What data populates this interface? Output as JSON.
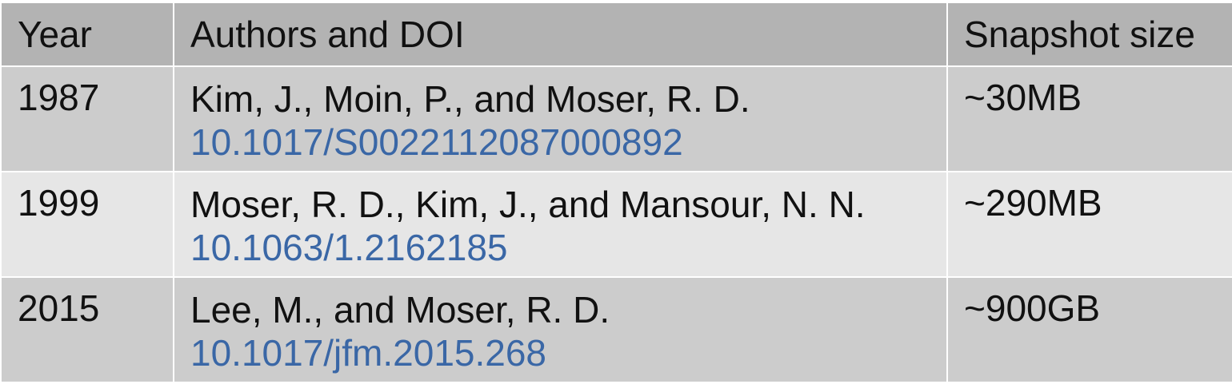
{
  "table": {
    "headers": [
      "Year",
      "Authors and DOI",
      "Snapshot size"
    ],
    "rows": [
      {
        "year": "1987",
        "authors": "Kim, J., Moin, P., and Moser, R. D.",
        "doi": "10.1017/S0022112087000892",
        "size": "~30MB"
      },
      {
        "year": "1999",
        "authors": "Moser, R. D., Kim, J., and Mansour, N. N.",
        "doi": "10.1063/1.2162185",
        "size": "~290MB"
      },
      {
        "year": "2015",
        "authors": "Lee, M., and Moser, R. D.",
        "doi": "10.1017/jfm.2015.268",
        "size": "~900GB"
      }
    ]
  },
  "colors": {
    "header_bg": "#b3b3b3",
    "row_odd_bg": "#cccccc",
    "row_even_bg": "#e6e6e6",
    "link": "#3a67a6",
    "text": "#111111"
  }
}
